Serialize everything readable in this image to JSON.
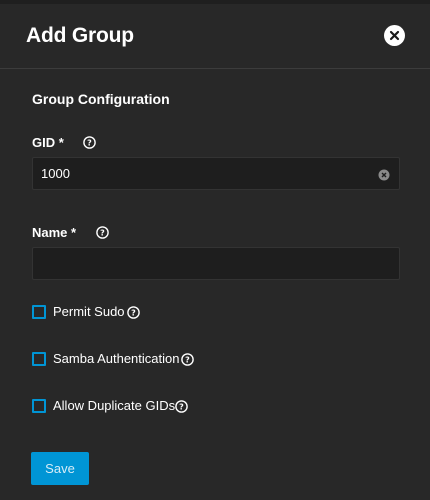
{
  "dialog": {
    "title": "Add Group"
  },
  "form": {
    "section_title": "Group Configuration",
    "gid": {
      "label": "GID *",
      "value": "1000"
    },
    "name": {
      "label": "Name *",
      "value": ""
    },
    "checkboxes": [
      {
        "label": "Permit Sudo",
        "checked": false
      },
      {
        "label": "Samba Authentication",
        "checked": false
      },
      {
        "label": "Allow Duplicate GIDs",
        "checked": false
      }
    ],
    "save_label": "Save"
  },
  "colors": {
    "background": "#282828",
    "input_background": "#1e1e1e",
    "accent": "#0095d5"
  },
  "icons": {
    "close": "close-circle-icon",
    "help": "help-circle-icon",
    "clear": "clear-circle-icon"
  }
}
